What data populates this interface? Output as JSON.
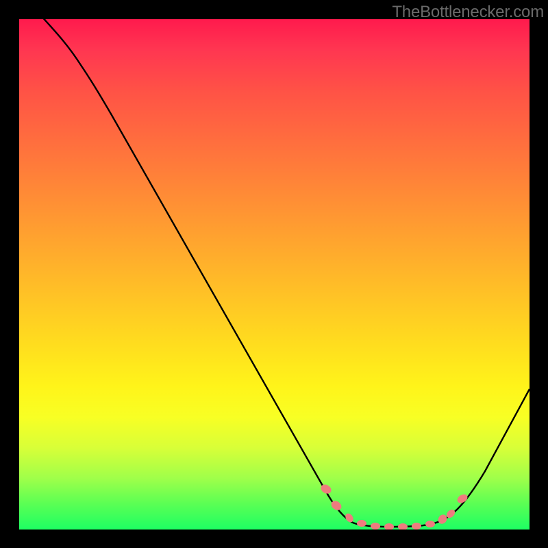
{
  "watermark": "TheBottlenecker.com",
  "chart_data": {
    "type": "line",
    "title": "",
    "xlabel": "",
    "ylabel": "",
    "xlim": [
      0,
      100
    ],
    "ylim": [
      0,
      100
    ],
    "note": "No axes, ticks, or numeric labels are rendered in the image. X and Y values are estimated from pixel positions on a normalized 0-100 scale (0,0 = bottom-left of gradient plot area).",
    "series": [
      {
        "name": "curve",
        "x": [
          0,
          4,
          8,
          12,
          16,
          22,
          30,
          38,
          46,
          54,
          60,
          64,
          68,
          72,
          76,
          80,
          84,
          88,
          92,
          96,
          100
        ],
        "y": [
          106,
          102,
          97,
          91,
          84,
          73,
          59,
          45,
          31,
          17,
          8,
          4,
          2,
          1,
          1,
          2,
          4,
          8,
          14,
          22,
          31
        ]
      }
    ],
    "markers": [
      {
        "x": 60,
        "y": 8
      },
      {
        "x": 63,
        "y": 5
      },
      {
        "x": 66,
        "y": 3
      },
      {
        "x": 69,
        "y": 2
      },
      {
        "x": 72,
        "y": 1.5
      },
      {
        "x": 75,
        "y": 1.5
      },
      {
        "x": 78,
        "y": 1.5
      },
      {
        "x": 81,
        "y": 2
      },
      {
        "x": 84,
        "y": 3
      },
      {
        "x": 85,
        "y": 4
      },
      {
        "x": 88,
        "y": 8
      }
    ],
    "marker_color": "#ee7c7e",
    "curve_color": "#000000",
    "gradient_stops": [
      {
        "offset": 0,
        "color": "#ff1a4d"
      },
      {
        "offset": 100,
        "color": "#1eff63"
      }
    ]
  }
}
